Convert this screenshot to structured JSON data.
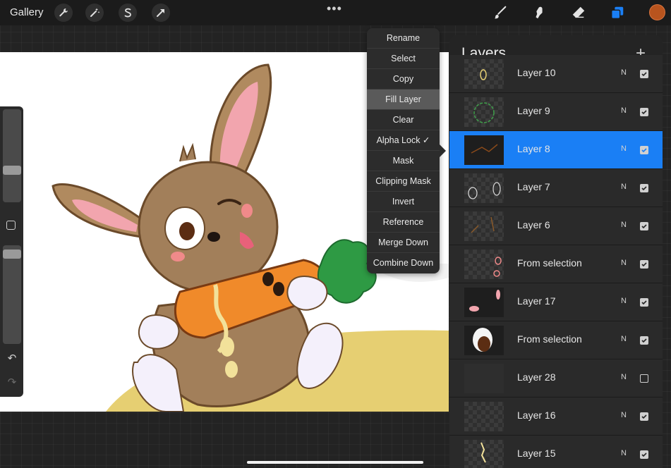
{
  "topbar": {
    "gallery_label": "Gallery",
    "left_tools": [
      "wrench-icon",
      "magic-wand-icon",
      "selection-s-icon",
      "transform-arrow-icon"
    ],
    "more_label": "•••",
    "right_tools": [
      "brush-icon",
      "smudge-icon",
      "eraser-icon",
      "layers-icon"
    ],
    "active_color": "#b8541e"
  },
  "menu": {
    "items": [
      {
        "label": "Rename"
      },
      {
        "label": "Select"
      },
      {
        "label": "Copy"
      },
      {
        "label": "Fill Layer"
      },
      {
        "label": "Clear"
      },
      {
        "label": "Alpha Lock ✓"
      },
      {
        "label": "Mask"
      },
      {
        "label": "Clipping Mask"
      },
      {
        "label": "Invert"
      },
      {
        "label": "Reference"
      },
      {
        "label": "Merge Down"
      },
      {
        "label": "Combine Down"
      }
    ],
    "highlighted": "Fill Layer"
  },
  "layers_panel": {
    "title": "Layers",
    "add_label": "+",
    "layers": [
      {
        "name": "Layer 10",
        "blend": "N",
        "visible": true
      },
      {
        "name": "Layer 9",
        "blend": "N",
        "visible": true
      },
      {
        "name": "Layer 8",
        "blend": "N",
        "visible": true,
        "active": true
      },
      {
        "name": "Layer 7",
        "blend": "N",
        "visible": true
      },
      {
        "name": "Layer 6",
        "blend": "N",
        "visible": true
      },
      {
        "name": "From selection",
        "blend": "N",
        "visible": true
      },
      {
        "name": "Layer 17",
        "blend": "N",
        "visible": true
      },
      {
        "name": "From selection",
        "blend": "N",
        "visible": true
      },
      {
        "name": "Layer 28",
        "blend": "N",
        "visible": false
      },
      {
        "name": "Layer 16",
        "blend": "N",
        "visible": true
      },
      {
        "name": "Layer 15",
        "blend": "N",
        "visible": true
      }
    ]
  },
  "colors": {
    "accent": "#1a7ff5",
    "panel": "#242424",
    "canvas": "#ffffff"
  }
}
